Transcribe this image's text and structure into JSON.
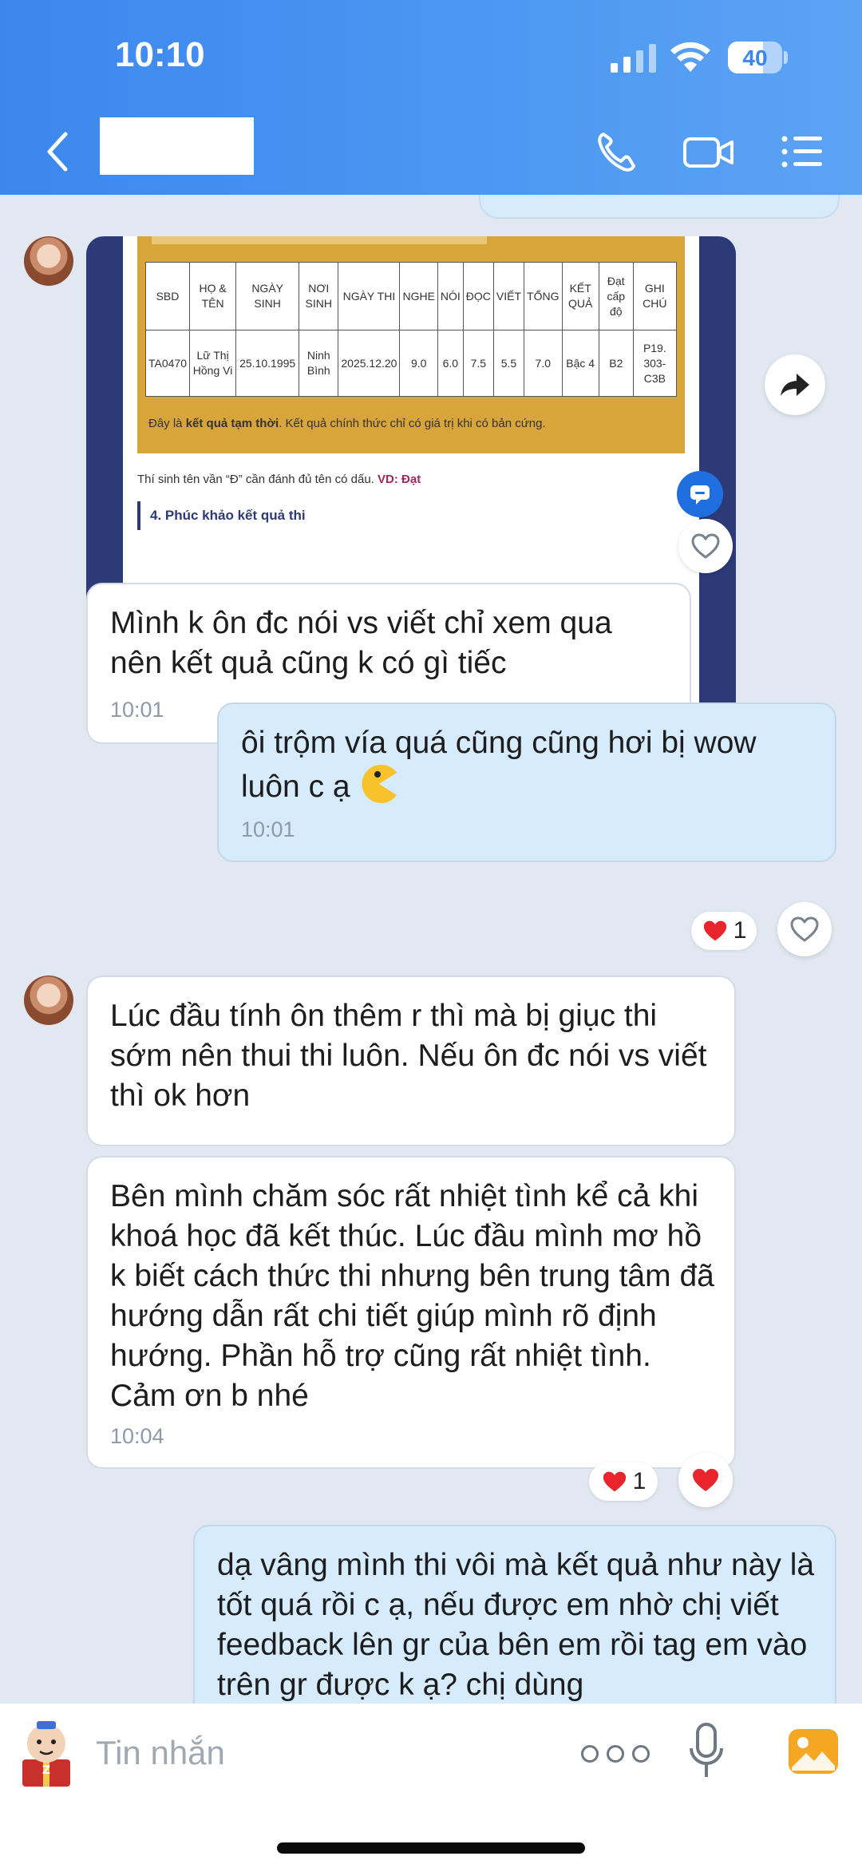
{
  "status_bar": {
    "time": "10:10",
    "battery": "40"
  },
  "header": {
    "contact_name_redacted": ""
  },
  "image_card": {
    "table_headers": [
      "SBD",
      "HỌ & TÊN",
      "NGÀY SINH",
      "NƠI SINH",
      "NGÀY THI",
      "NGHE",
      "NÓI",
      "ĐỌC",
      "VIẾT",
      "TỔNG",
      "KẾT QUẢ",
      "Đạt cấp độ",
      "GHI CHÚ"
    ],
    "table_row": [
      "TA0470",
      "Lữ Thị Hồng Vi",
      "25.10.1995",
      "Ninh Bình",
      "2025.12.20",
      "9.0",
      "6.0",
      "7.5",
      "5.5",
      "7.0",
      "Bậc 4",
      "B2",
      "P19. 303-C3B"
    ],
    "note_prefix": "Đây là ",
    "note_bold": "kết quả tạm thời",
    "note_suffix": ". Kết quả chính thức chỉ có giá trị khi có bản cứng.",
    "name_note": "Thí sinh tên vần “Đ” cần đánh đủ tên có dấu. ",
    "name_note_example": "VD: Đạt",
    "section_title": "4. Phúc khảo kết quả thi"
  },
  "messages": [
    {
      "text": "Mình k ôn đc nói vs viết chỉ xem qua nên kết quả cũng k có gì tiếc",
      "time": "10:01"
    },
    {
      "text": "ôi trộm vía quá cũng cũng hơi bị wow luôn c ạ",
      "emoji": "pacman",
      "time": "10:01",
      "reaction_count": "1"
    },
    {
      "text": "Lúc đầu tính ôn thêm r thì mà bị giục thi sớm nên thui thi luôn. Nếu ôn đc nói vs viết thì ok hơn"
    },
    {
      "text": "Bên mình chăm sóc rất nhiệt tình kể cả khi khoá học đã kết thúc. Lúc đầu mình mơ hồ k biết cách thức thi nhưng bên trung tâm đã hướng dẫn rất chi tiết giúp mình rõ định hướng. Phần hỗ trợ cũng rất nhiệt tình. Cảm ơn b nhé",
      "time": "10:04",
      "reaction_count": "1"
    },
    {
      "text": "dạ vâng mình thi vôi mà kết quả như này là tốt quá rồi c ạ, nếu được em nhờ chị viết feedback lên gr của bên em rồi tag em vào trên gr được k ạ? chị dùng"
    }
  ],
  "composer": {
    "placeholder": "Tin nhắn"
  },
  "colors": {
    "header_blue": "#3b87ee",
    "bubble_out": "#d6ebfb",
    "bubble_in": "#ffffff",
    "heart_red": "#e8242c",
    "chat_bg": "#e2e8f1"
  },
  "icons": [
    "back-icon",
    "phone-icon",
    "video-icon",
    "menu-icon",
    "share-icon",
    "heart-icon",
    "chat-support-icon",
    "sticker-icon",
    "more-icon",
    "mic-icon",
    "photo-icon"
  ]
}
